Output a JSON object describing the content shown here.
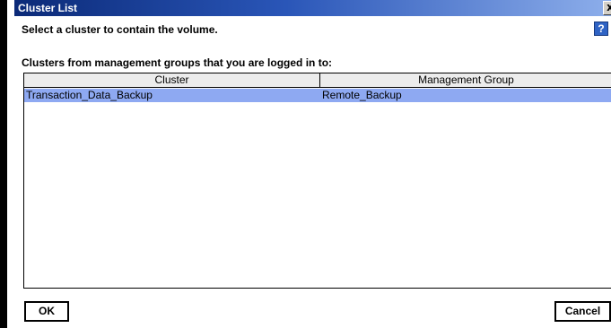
{
  "window": {
    "title": "Cluster List",
    "close_glyph": "x"
  },
  "dialog": {
    "instruction": "Select a cluster to contain the volume.",
    "help_glyph": "?",
    "list_caption": "Clusters from management groups that you are logged in to:"
  },
  "table": {
    "columns": [
      "Cluster",
      "Management Group"
    ],
    "rows": [
      {
        "cluster": "Transaction_Data_Backup",
        "management_group": "Remote_Backup",
        "selected": true
      }
    ]
  },
  "buttons": {
    "ok": "OK",
    "cancel": "Cancel"
  },
  "colors": {
    "selection": "#8ea9f2",
    "titlebar_start": "#0b2a78",
    "titlebar_end": "#8fb0ec"
  }
}
